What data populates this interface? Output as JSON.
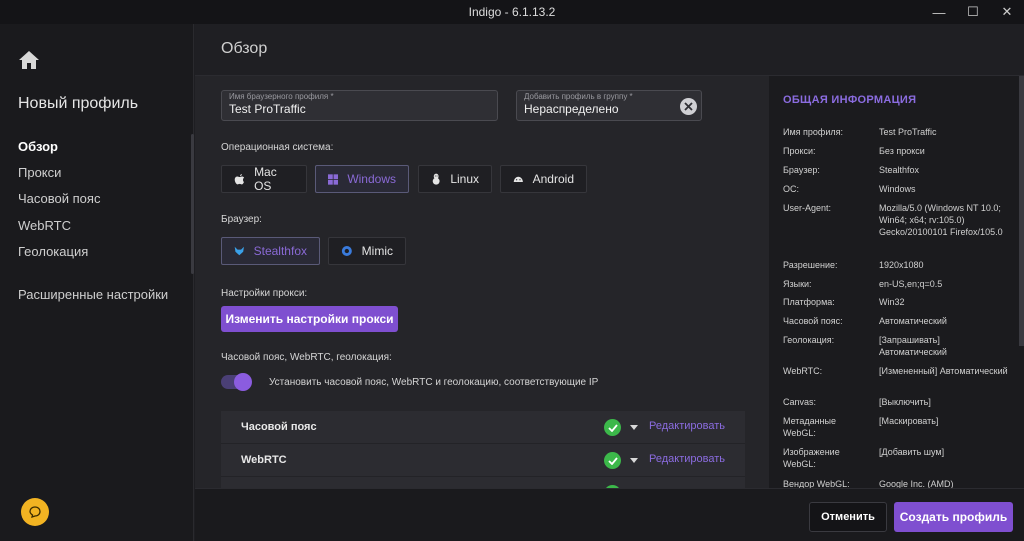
{
  "window": {
    "title": "Indigo - 6.1.13.2",
    "minimize": "—",
    "maximize": "☐",
    "close": "✕"
  },
  "sidebar": {
    "title": "Новый профиль",
    "items": [
      "Обзор",
      "Прокси",
      "Часовой пояс",
      "WebRTC",
      "Геолокация"
    ],
    "advanced": "Расширенные настройки"
  },
  "page": {
    "title": "Обзор"
  },
  "form": {
    "profile_name": {
      "label": "Имя браузерного профиля *",
      "value": "Test ProTraffic"
    },
    "group": {
      "label": "Добавить профиль в группу *",
      "value": "Нераспределено"
    },
    "os_label": "Операционная система:",
    "os_options": [
      "Mac OS",
      "Windows",
      "Linux",
      "Android"
    ],
    "os_selected": "Windows",
    "browser_label": "Браузер:",
    "browser_options": [
      "Stealthfox",
      "Mimic"
    ],
    "browser_selected": "Stealthfox",
    "proxy_label": "Настройки прокси:",
    "proxy_button": "Изменить настройки прокси",
    "tz_label": "Часовой пояс, WebRTC, геолокация:",
    "tz_toggle_text": "Установить часовой пояс, WebRTC и геолокацию, соответствующие IP",
    "rows": [
      {
        "label": "Часовой пояс",
        "action": "Редактировать"
      },
      {
        "label": "WebRTC",
        "action": "Редактировать"
      }
    ]
  },
  "info": {
    "title": "ОБЩАЯ ИНФОРМАЦИЯ",
    "items": [
      {
        "key": "Имя профиля:",
        "value": "Test ProTraffic"
      },
      {
        "key": "Прокси:",
        "value": "Без прокси"
      },
      {
        "key": "Браузер:",
        "value": "Stealthfox"
      },
      {
        "key": "ОС:",
        "value": "Windows"
      },
      {
        "key": "User-Agent:",
        "value": "Mozilla/5.0 (Windows NT 10.0; Win64; x64; rv:105.0) Gecko/20100101 Firefox/105.0"
      },
      {
        "key": "Разрешение:",
        "value": "1920x1080"
      },
      {
        "key": "Языки:",
        "value": "en-US,en;q=0.5"
      },
      {
        "key": "Платформа:",
        "value": "Win32"
      },
      {
        "key": "Часовой пояс:",
        "value": "Автоматический"
      },
      {
        "key": "Геолокация:",
        "value": "[Запрашивать] Автоматический"
      },
      {
        "key": "WebRTC:",
        "value": "[Измененный] Автоматический"
      },
      {
        "key": "Canvas:",
        "value": "[Выключить]"
      },
      {
        "key": "Метаданные WebGL:",
        "value": "[Маскировать]"
      },
      {
        "key": "Изображение WebGL:",
        "value": "[Добавить шум]"
      },
      {
        "key": "Вендор WebGL:",
        "value": "Google Inc. (AMD)"
      }
    ]
  },
  "footer": {
    "cancel": "Отменить",
    "create": "Создать профиль"
  },
  "colors": {
    "accent": "#7f4fd0",
    "link": "#8b6ce0",
    "check": "#3cb84a",
    "chat": "#f2b322"
  }
}
